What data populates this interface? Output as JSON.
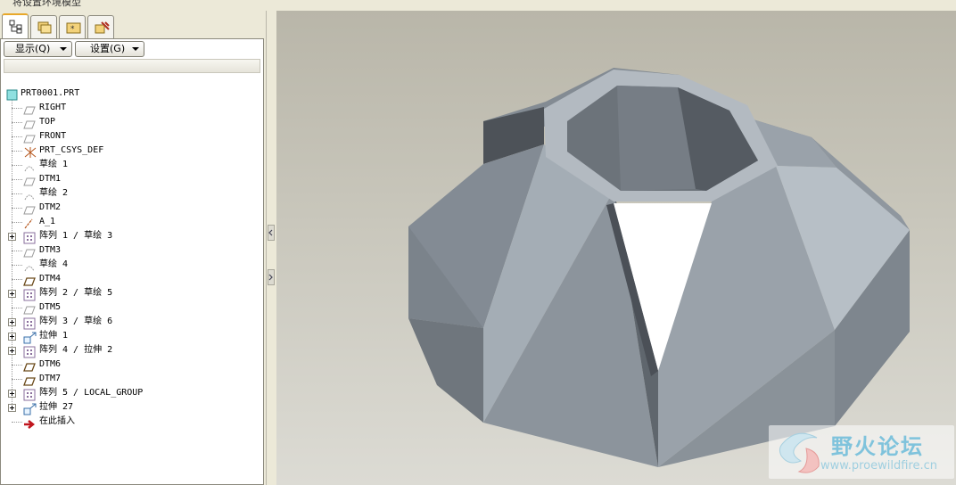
{
  "window": {
    "title": "将设置环境模型"
  },
  "tabs": [
    {
      "icon": "model-tree-icon",
      "active": true
    },
    {
      "icon": "folder-browser-icon",
      "active": false
    },
    {
      "icon": "favorites-icon",
      "active": false
    },
    {
      "icon": "connections-icon",
      "active": false
    }
  ],
  "toolbar": {
    "show_label": "显示(Q)",
    "settings_label": "设置(G)"
  },
  "tree": {
    "root": "PRT0001.PRT",
    "items": [
      {
        "label": "RIGHT",
        "icon": "datum-plane-icon",
        "expandable": false
      },
      {
        "label": "TOP",
        "icon": "datum-plane-icon",
        "expandable": false
      },
      {
        "label": "FRONT",
        "icon": "datum-plane-icon",
        "expandable": false
      },
      {
        "label": "PRT_CSYS_DEF",
        "icon": "coordinate-system-icon",
        "expandable": false
      },
      {
        "label": "草绘 1",
        "icon": "sketch-icon",
        "expandable": false
      },
      {
        "label": "DTM1",
        "icon": "datum-plane-icon",
        "expandable": false
      },
      {
        "label": "草绘 2",
        "icon": "sketch-icon",
        "expandable": false
      },
      {
        "label": "DTM2",
        "icon": "datum-plane-icon",
        "expandable": false
      },
      {
        "label": "A_1",
        "icon": "datum-axis-icon",
        "expandable": false
      },
      {
        "label": "阵列 1 / 草绘 3",
        "icon": "pattern-icon",
        "expandable": true
      },
      {
        "label": "DTM3",
        "icon": "datum-plane-icon",
        "expandable": false
      },
      {
        "label": "草绘 4",
        "icon": "sketch-icon",
        "expandable": false
      },
      {
        "label": "DTM4",
        "icon": "datum-plane-bold-icon",
        "expandable": false
      },
      {
        "label": "阵列 2 / 草绘 5",
        "icon": "pattern-icon",
        "expandable": true
      },
      {
        "label": "DTM5",
        "icon": "datum-plane-icon",
        "expandable": false
      },
      {
        "label": "阵列 3 / 草绘 6",
        "icon": "pattern-icon",
        "expandable": true
      },
      {
        "label": "拉伸 1",
        "icon": "extrude-icon",
        "expandable": true
      },
      {
        "label": "阵列 4 / 拉伸 2",
        "icon": "pattern-icon",
        "expandable": true
      },
      {
        "label": "DTM6",
        "icon": "datum-plane-bold-icon",
        "expandable": false
      },
      {
        "label": "DTM7",
        "icon": "datum-plane-bold-icon",
        "expandable": false
      },
      {
        "label": "阵列 5 / LOCAL_GROUP",
        "icon": "pattern-icon",
        "expandable": true
      },
      {
        "label": "拉伸 27",
        "icon": "extrude-icon",
        "expandable": true
      },
      {
        "label": "在此插入",
        "icon": "insert-here-arrow-icon",
        "expandable": false
      }
    ]
  },
  "watermark": {
    "title": "野火论坛",
    "url": "www.proewildfire.cn"
  },
  "colors": {
    "viewport_top": "#b9b6a9",
    "viewport_bottom": "#dcdbd4",
    "model_light": "#b4bcc4",
    "model_dark": "#5a6168",
    "accent_tab": "#e8a82a"
  }
}
